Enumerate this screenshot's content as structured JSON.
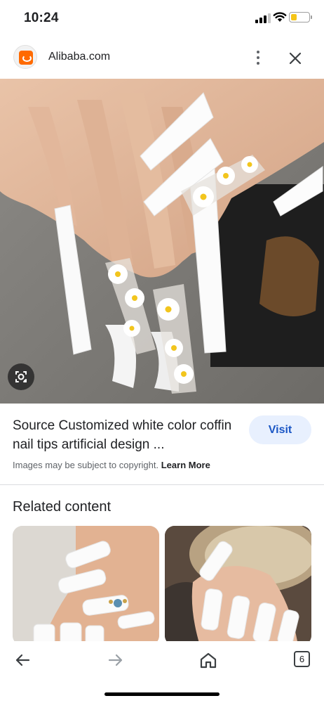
{
  "status_bar": {
    "time": "10:24",
    "icons": [
      "signal-icon",
      "wifi-icon",
      "battery-icon"
    ],
    "battery_level": 0.35,
    "battery_color": "#f5c518"
  },
  "header": {
    "site_name": "Alibaba.com",
    "logo_color": "#ff6a00",
    "icons": [
      "alibaba-logo-icon",
      "more-vertical-icon",
      "close-icon"
    ]
  },
  "result": {
    "title": "Source Customized white color coffin nail tips artificial design ...",
    "visit_label": "Visit",
    "copyright_text": "Images may be subject to copyright.",
    "learn_more_label": "Learn More"
  },
  "related": {
    "heading": "Related content"
  },
  "toolbar": {
    "tab_count": "6",
    "icons": [
      "back-arrow-icon",
      "forward-arrow-icon",
      "home-icon",
      "tabs-icon"
    ]
  },
  "colors": {
    "accent": "#1a56c5",
    "visit_bg": "#e8f0fe",
    "text_secondary": "#5f6368"
  }
}
